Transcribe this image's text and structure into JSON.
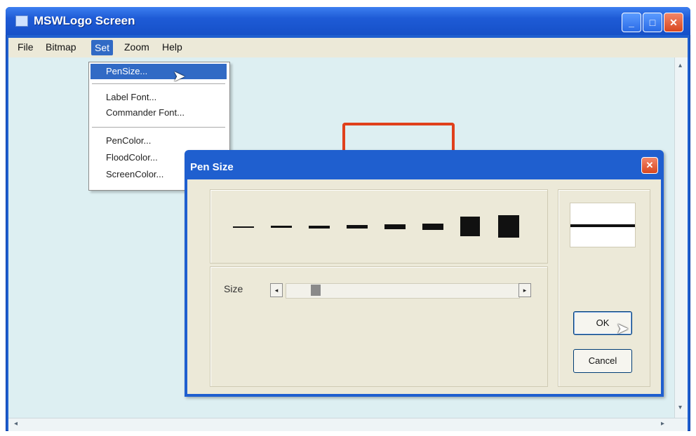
{
  "window": {
    "title": "MSWLogo Screen",
    "minimize_glyph": "_",
    "maximize_glyph": "□",
    "close_glyph": "✕"
  },
  "menubar": {
    "items": [
      "File",
      "Bitmap",
      "Set",
      "Zoom",
      "Help"
    ]
  },
  "set_menu": {
    "items": [
      "PenSize...",
      "Label Font...",
      "Commander Font...",
      "PenColor...",
      "FloodColor...",
      "ScreenColor..."
    ]
  },
  "dialog": {
    "title": "Pen Size",
    "close_glyph": "✕",
    "size_label": "Size",
    "ok_label": "OK",
    "cancel_label": "Cancel",
    "pen_widths_available": 8,
    "selected_pen_size_fraction": 0.1
  },
  "colors": {
    "accent": "#316ac5",
    "titlebar": "#1f5fcf",
    "canvas": "#ddeff2",
    "drawing": "#e0401c"
  },
  "icons": {
    "scroll_left": "◂",
    "scroll_right": "▸",
    "scroll_up": "▴",
    "scroll_down": "▾",
    "cursor": "➤"
  }
}
